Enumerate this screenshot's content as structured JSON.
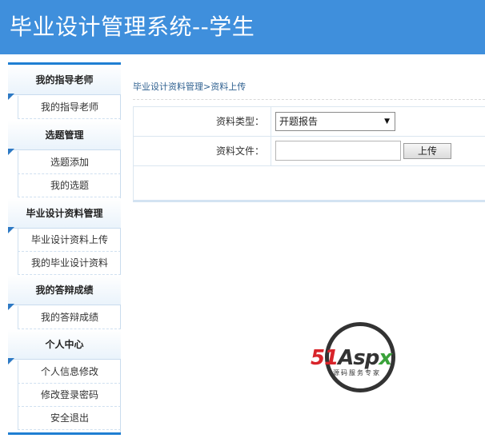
{
  "header": {
    "title": "毕业设计管理系统--学生"
  },
  "sidebar": {
    "sections": [
      {
        "title": "我的指导老师",
        "items": [
          "我的指导老师"
        ]
      },
      {
        "title": "选题管理",
        "items": [
          "选题添加",
          "我的选题"
        ]
      },
      {
        "title": "毕业设计资料管理",
        "items": [
          "毕业设计资料上传",
          "我的毕业设计资料"
        ]
      },
      {
        "title": "我的答辩成绩",
        "items": [
          "我的答辩成绩"
        ]
      },
      {
        "title": "个人中心",
        "items": [
          "个人信息修改",
          "修改登录密码",
          "安全退出"
        ]
      }
    ]
  },
  "breadcrumb": {
    "parent": "毕业设计资料管理",
    "sep": ">",
    "current": "资料上传"
  },
  "form": {
    "type_label": "资料类型：",
    "type_value": "开题报告",
    "file_label": "资料文件：",
    "upload_label": "上传"
  },
  "watermark": {
    "brand_51": "51",
    "brand_asp": "Asp",
    "brand_x": "x",
    "sub": "源码服务专家"
  },
  "colors": {
    "header": "#3f8fdc",
    "accent": "#1f7fd2"
  }
}
